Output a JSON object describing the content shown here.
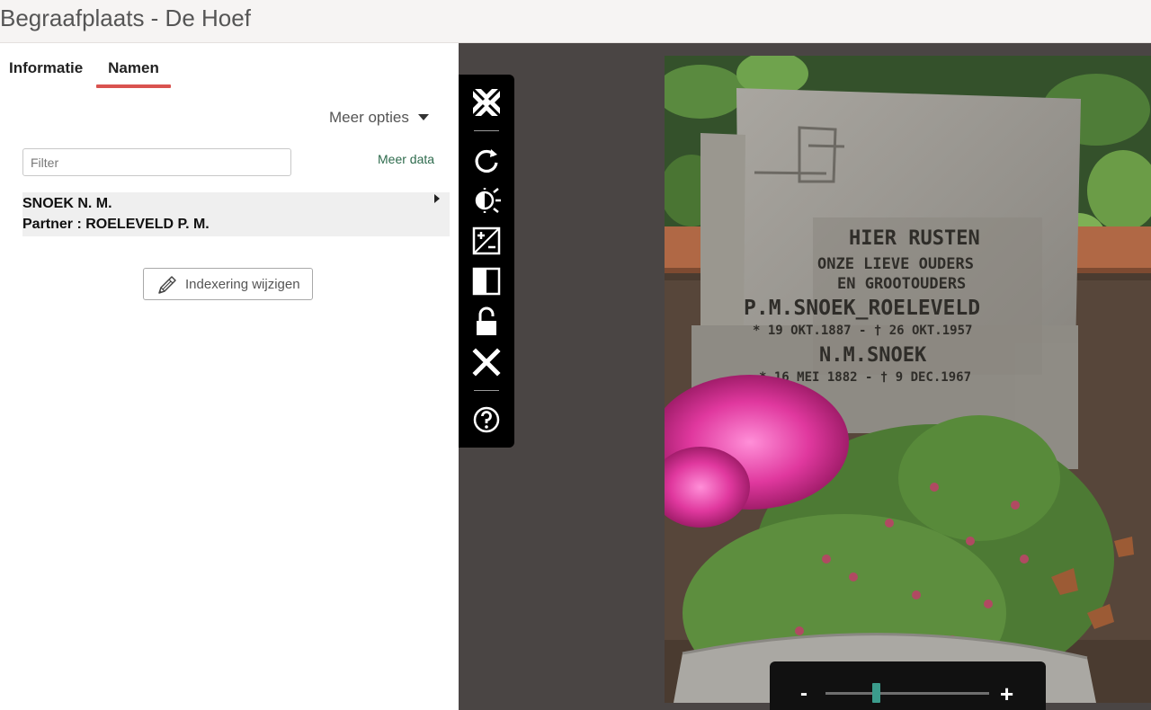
{
  "app": {
    "title": "Begraafplaats - De Hoef"
  },
  "tabs": [
    {
      "label": "Informatie"
    },
    {
      "label": "Namen"
    }
  ],
  "active_tab": "Namen",
  "options": {
    "label": "Meer opties"
  },
  "filter": {
    "placeholder": "Filter",
    "value": ""
  },
  "meer_data": {
    "label": "Meer data"
  },
  "records": [
    {
      "name": "SNOEK N. M.",
      "partner": "Partner : ROELEVELD P. M."
    }
  ],
  "index_button": {
    "label": "Indexering wijzigen"
  },
  "viewer": {
    "toolbar": [
      {
        "name": "fullscreen-icon"
      },
      {
        "name": "rotate-icon"
      },
      {
        "name": "brightness-icon"
      },
      {
        "name": "contrast-icon"
      },
      {
        "name": "invert-icon"
      },
      {
        "name": "lock-icon"
      },
      {
        "name": "close-icon"
      },
      {
        "name": "help-icon"
      }
    ],
    "zoom": {
      "minus": "-",
      "plus": "+",
      "level": 0.31
    },
    "inscription": [
      "HIER RUSTEN",
      "ONZE LIEVE OUDERS",
      "EN GROOTOUDERS",
      "P.M.SNOEK_ROELEVELD",
      "* 19 OKT.1887 - † 26 OKT.1957",
      "N.M.SNOEK",
      "* 16 MEI 1882 - † 9 DEC.1967"
    ]
  },
  "colors": {
    "accent": "#d9534f",
    "link": "#2e6b4d",
    "viewer_bg": "#4a4544",
    "slider": "#3b9c8c"
  }
}
